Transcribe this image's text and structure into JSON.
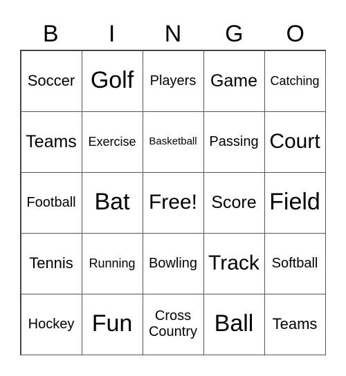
{
  "header": [
    "B",
    "I",
    "N",
    "G",
    "O"
  ],
  "cells": [
    {
      "text": "Soccer",
      "size": "s-n"
    },
    {
      "text": "Golf",
      "size": "s-xl"
    },
    {
      "text": "Players",
      "size": "s-s"
    },
    {
      "text": "Game",
      "size": "s-m"
    },
    {
      "text": "Catching",
      "size": "s-xs"
    },
    {
      "text": "Teams",
      "size": "s-m"
    },
    {
      "text": "Exercise",
      "size": "s-xs"
    },
    {
      "text": "Basketball",
      "size": "s-xxs"
    },
    {
      "text": "Passing",
      "size": "s-s"
    },
    {
      "text": "Court",
      "size": "s-l"
    },
    {
      "text": "Football",
      "size": "s-s"
    },
    {
      "text": "Bat",
      "size": "s-xl"
    },
    {
      "text": "Free!",
      "size": "s-l"
    },
    {
      "text": "Score",
      "size": "s-m"
    },
    {
      "text": "Field",
      "size": "s-xl"
    },
    {
      "text": "Tennis",
      "size": "s-n"
    },
    {
      "text": "Running",
      "size": "s-xs"
    },
    {
      "text": "Bowling",
      "size": "s-s"
    },
    {
      "text": "Track",
      "size": "s-l"
    },
    {
      "text": "Softball",
      "size": "s-s"
    },
    {
      "text": "Hockey",
      "size": "s-s"
    },
    {
      "text": "Fun",
      "size": "s-xl"
    },
    {
      "text": "Cross Country",
      "size": "s-s"
    },
    {
      "text": "Ball",
      "size": "s-xl"
    },
    {
      "text": "Teams",
      "size": "s-n"
    }
  ]
}
